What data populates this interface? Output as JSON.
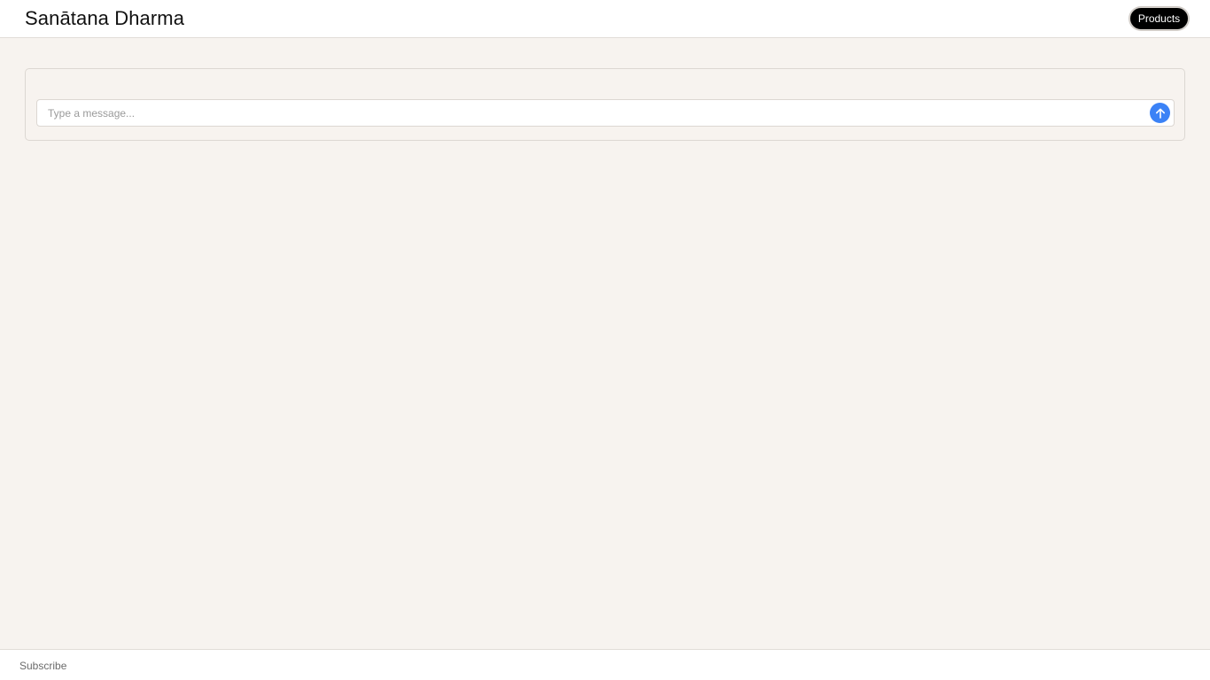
{
  "header": {
    "title": "Sanātana Dharma",
    "products_label": "Products"
  },
  "chat": {
    "placeholder": "Type a message...",
    "send_icon": "arrow-up-icon",
    "accent_color": "#3b82f6"
  },
  "footer": {
    "subscribe_label": "Subscribe"
  }
}
